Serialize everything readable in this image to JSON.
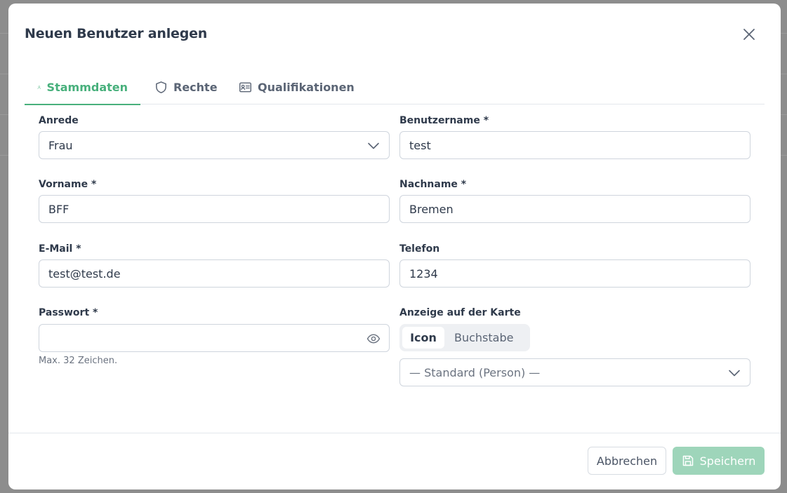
{
  "modal": {
    "title": "Neuen Benutzer anlegen",
    "close_icon": "close-icon"
  },
  "tabs": [
    {
      "label": "Stammdaten",
      "icon": "user-icon",
      "active": true
    },
    {
      "label": "Rechte",
      "icon": "shield-icon",
      "active": false
    },
    {
      "label": "Qualifikationen",
      "icon": "id-card-icon",
      "active": false
    }
  ],
  "form": {
    "anrede": {
      "label": "Anrede",
      "value": "Frau"
    },
    "benutzername": {
      "label": "Benutzername *",
      "value": "test"
    },
    "vorname": {
      "label": "Vorname *",
      "value": "BFF"
    },
    "nachname": {
      "label": "Nachname *",
      "value": "Bremen"
    },
    "email": {
      "label": "E-Mail *",
      "value": "test@test.de"
    },
    "telefon": {
      "label": "Telefon",
      "value": "1234"
    },
    "passwort": {
      "label": "Passwort *",
      "value": "",
      "hint": "Max. 32 Zeichen."
    },
    "anzeige": {
      "label": "Anzeige auf der Karte",
      "options": [
        "Icon",
        "Buchstabe"
      ],
      "selected": "Icon",
      "icon_select_value": "— Standard (Person) —"
    }
  },
  "footer": {
    "cancel_label": "Abbrechen",
    "save_label": "Speichern"
  },
  "colors": {
    "accent": "#48b07c",
    "save_disabled": "#9ed5ba",
    "text": "#2f3a4b"
  }
}
